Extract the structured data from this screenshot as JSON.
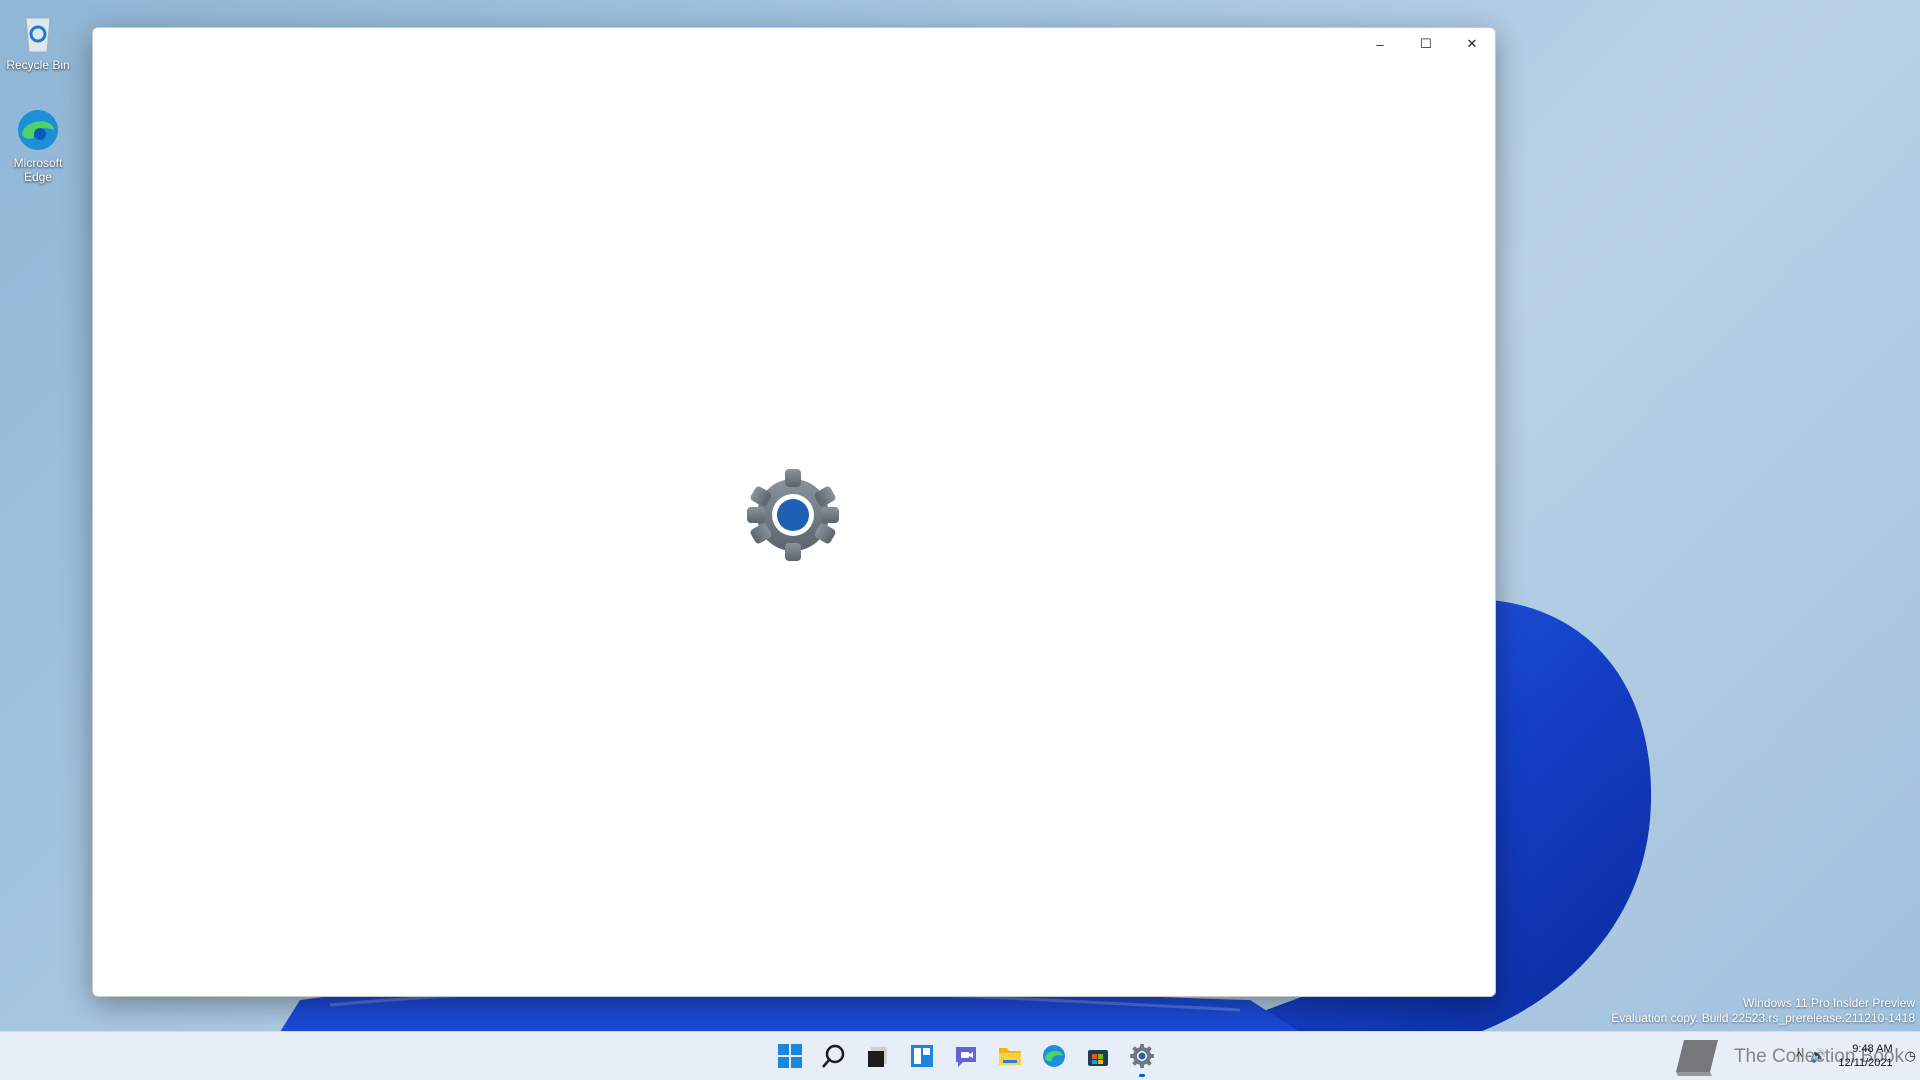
{
  "desktop": {
    "icons": [
      {
        "label": "Recycle Bin"
      },
      {
        "label": "Microsoft Edge"
      }
    ],
    "watermark": {
      "line1": "Windows 11 Pro Insider Preview",
      "line2": "Evaluation copy. Build 22523.rs_prerelease.211210-1418"
    }
  },
  "window": {
    "minimize_glyph": "–",
    "maximize_glyph": "☐",
    "close_glyph": "✕",
    "splash_icon": "gear-icon"
  },
  "taskbar": {
    "apps": [
      "start",
      "search",
      "task-view",
      "widgets",
      "chat",
      "file-explorer",
      "edge",
      "store",
      "settings"
    ],
    "active_app": "settings",
    "tray_chevron": "^",
    "clock_time": "9:48 AM",
    "clock_date": "12/11/2021",
    "brand_text": "The Collection Book"
  },
  "colors": {
    "accent": "#0067c0",
    "bloom": "#1a4fd6"
  }
}
